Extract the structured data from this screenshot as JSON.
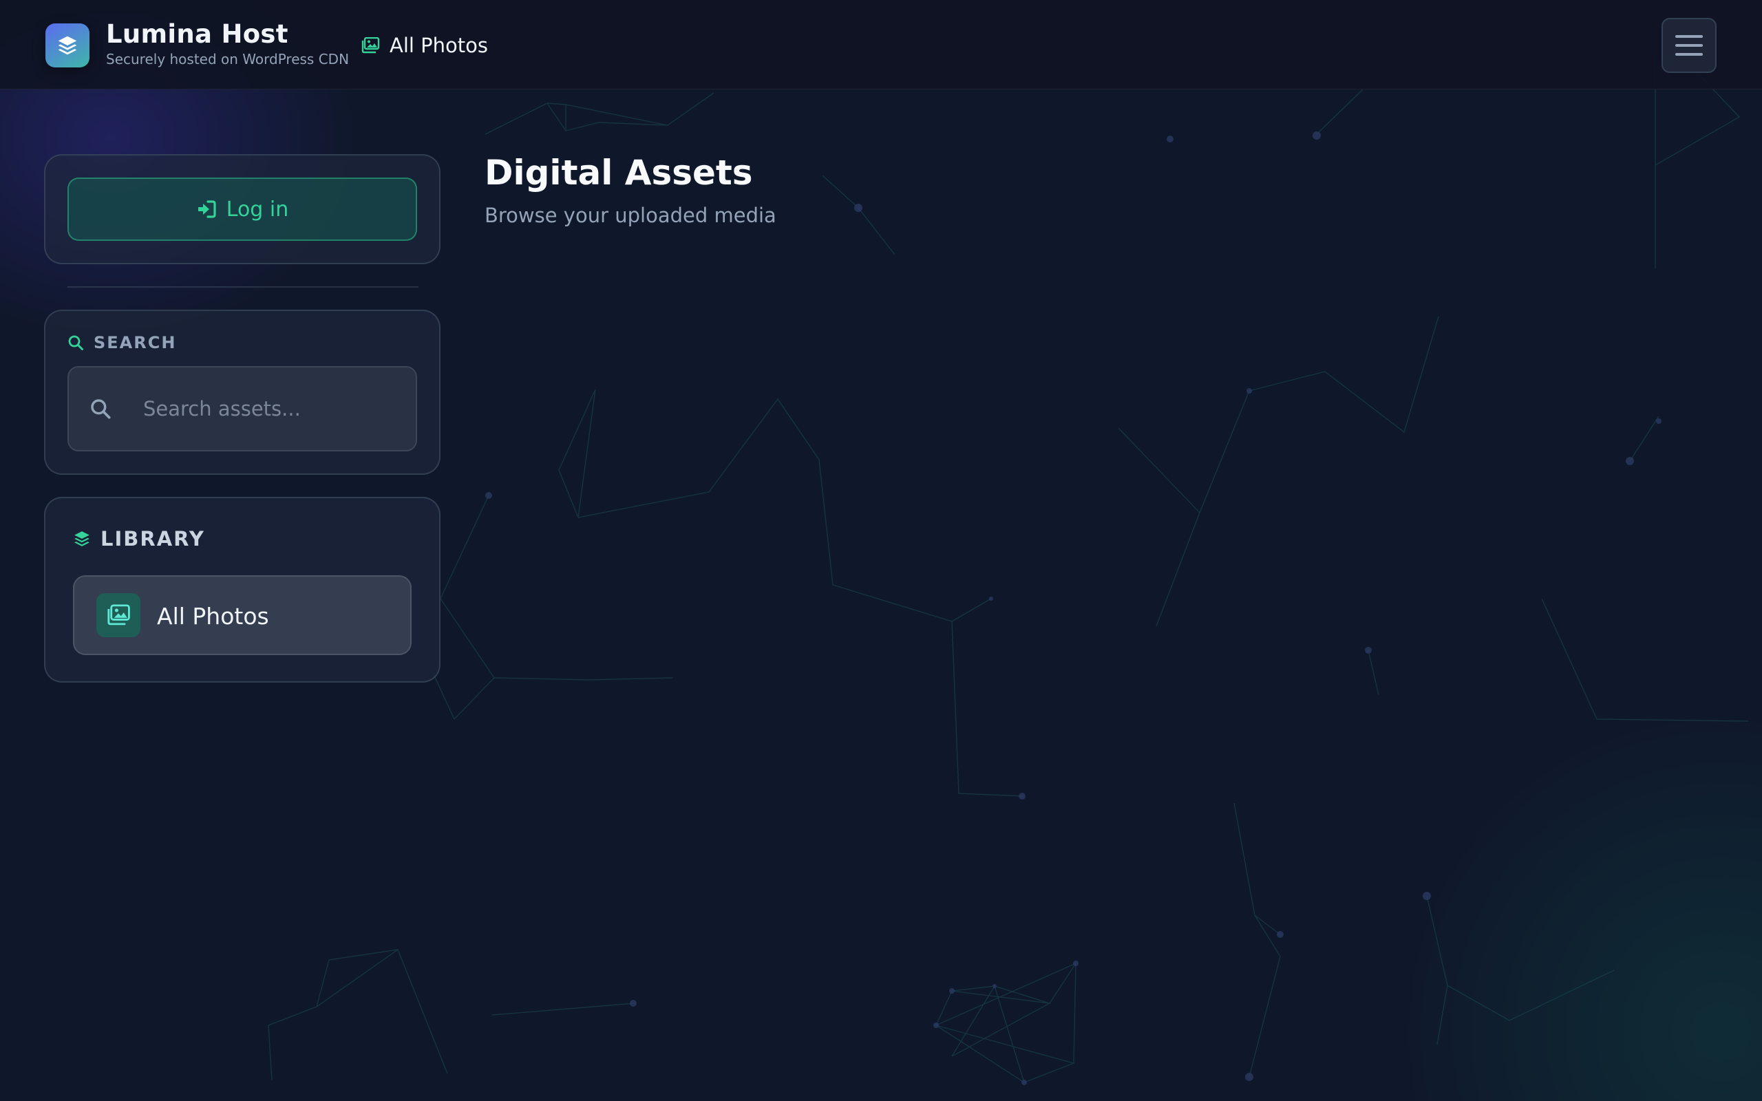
{
  "header": {
    "app_name": "Lumina Host",
    "tagline": "Securely hosted on WordPress CDN",
    "logo_icon": "layers-icon",
    "nav": {
      "label": "All Photos",
      "icon": "images-icon"
    },
    "menu_icon": "hamburger-menu-icon"
  },
  "sidebar": {
    "login": {
      "label": "Log in",
      "icon": "sign-in-icon"
    },
    "search": {
      "heading": "SEARCH",
      "heading_icon": "search-icon",
      "placeholder": "Search assets...",
      "value": ""
    },
    "library": {
      "heading": "LIBRARY",
      "heading_icon": "layers-icon",
      "items": [
        {
          "label": "All Photos",
          "icon": "images-icon",
          "active": true
        }
      ]
    }
  },
  "main": {
    "title": "Digital Assets",
    "subtitle": "Browse your uploaded media"
  },
  "colors": {
    "background": "#0f172a",
    "accent": "#34d399",
    "card": "#1e293b",
    "muted_text": "#94a3b8"
  }
}
